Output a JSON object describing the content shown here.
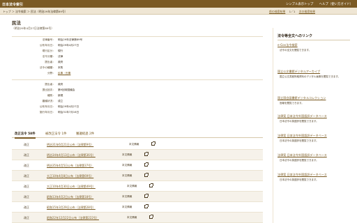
{
  "header": {
    "site_title": "日本法令索引",
    "links": [
      "シンプル表示トップ",
      "ヘルプ（使い方ガイド）"
    ]
  },
  "breadcrumb": {
    "trail": "トップ ＞ 法令検索 ＞ 民法（明治29年法律第89号）",
    "nav": [
      "前の検索結果",
      "1／1",
      "次の検索結果"
    ]
  },
  "law": {
    "title": "民法",
    "subtitle": "（明治29年4月27日法律第89号）"
  },
  "info1": [
    {
      "k": "法律番号：",
      "v": "明治29年法律第89号"
    },
    {
      "k": "公布年月日：",
      "v": "明治29年4月27日"
    },
    {
      "k": "現行区分：",
      "v": "現行"
    },
    {
      "k": "法令分類：",
      "v": "法律"
    },
    {
      "k": "提出者：",
      "v": "政府"
    },
    {
      "k": "法令の種類：",
      "v": "本則"
    },
    {
      "k": "分野：",
      "v": "民事・刑事"
    }
  ],
  "info2": [
    {
      "k": "提出者：",
      "v": "政府"
    },
    {
      "k": "提出回次：",
      "v": "第9回帝国議会"
    },
    {
      "k": "種別：",
      "v": "新規"
    },
    {
      "k": "審議状況：",
      "v": "成立"
    },
    {
      "k": "公布年月日：",
      "v": "明治29年4月27日"
    },
    {
      "k": "施行年月日：",
      "v": "明治31年7月16日"
    }
  ],
  "tabs": [
    "改正法令 58件",
    "被改正法令 1件",
    "審議経過 2件"
  ],
  "revisions": [
    {
      "tag": "改正",
      "name": "明治31年6月21日公布（法律第9号）",
      "info": "本文情報"
    },
    {
      "tag": "改正",
      "name": "明治34年4月13日公布（法律第36号）",
      "info": "本文情報"
    },
    {
      "tag": "改正",
      "name": "明治35年4月5日公布（法律第37号）",
      "info": "本文情報"
    },
    {
      "tag": "改正",
      "name": "大正10年4月8日公布（法律第69号）",
      "info": "本文情報"
    },
    {
      "tag": "改正",
      "name": "大正10年4月30日公布（法律第49号）",
      "info": "本文情報"
    },
    {
      "tag": "改正",
      "name": "昭和13年4月2日公布（法律第18号）",
      "info": "本文情報"
    },
    {
      "tag": "改正",
      "name": "昭和15年3月29日公布（法律第28号）",
      "info": "本文情報"
    },
    {
      "tag": "改正",
      "name": "昭和22年12月22日公布（法律第222号）",
      "info": "本文情報"
    }
  ],
  "sidebar": {
    "heading": "法令等全文へのリンク",
    "items": [
      {
        "title": "e-Gov法令検索",
        "desc": "法令の全文を閲覧できます。"
      },
      {
        "title": "国立公文書館デジタルアーカイブ",
        "desc": "国立公文書館所蔵資料のデジタル画像を閲覧できます。"
      },
      {
        "title": "国立国会図書館デジタルコレクション",
        "desc": "官報を閲覧できます。"
      },
      {
        "title": "法律案 日本法令外国語訳データベース",
        "desc": "日本法令の英語訳を閲覧できます。"
      },
      {
        "title": "法律案 日本法令外国語訳データベース",
        "desc": "日本法令の英語訳を閲覧できます。"
      },
      {
        "title": "法律案 日本法令外国語訳データベース",
        "desc": "日本法令の英語訳を閲覧できます。"
      },
      {
        "title": "法律案 日本法令外国語訳データベース",
        "desc": "日本法令の英語訳を閲覧できます。"
      }
    ]
  }
}
